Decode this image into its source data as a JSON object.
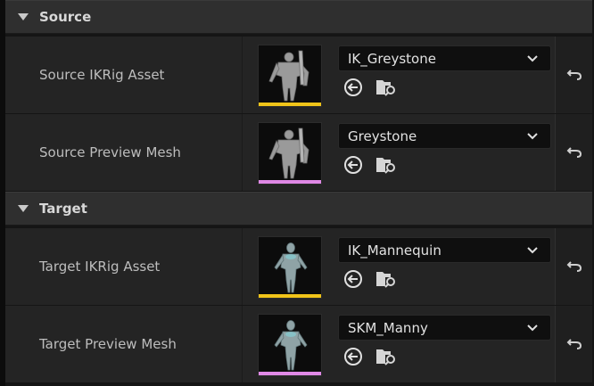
{
  "colors": {
    "ikrig_bar": "#f0c419",
    "mesh_bar": "#e089e6",
    "panel_bg": "#242424",
    "header_bg": "#2f2f2f"
  },
  "sections": [
    {
      "title": "Source",
      "rows": [
        {
          "label": "Source IKRig Asset",
          "value": "IK_Greystone",
          "asset_type": "ikrig",
          "thumb_icon": "greystone-thumbnail"
        },
        {
          "label": "Source Preview Mesh",
          "value": "Greystone",
          "asset_type": "mesh",
          "thumb_icon": "greystone-thumbnail"
        }
      ]
    },
    {
      "title": "Target",
      "rows": [
        {
          "label": "Target IKRig Asset",
          "value": "IK_Mannequin",
          "asset_type": "ikrig",
          "thumb_icon": "mannequin-thumbnail"
        },
        {
          "label": "Target Preview Mesh",
          "value": "SKM_Manny",
          "asset_type": "mesh",
          "thumb_icon": "mannequin-thumbnail"
        }
      ]
    }
  ],
  "icons": {
    "collapse": "triangle-down-icon",
    "dropdown": "chevron-down-icon",
    "use_selected": "use-selected-asset-icon",
    "browse": "browse-to-asset-icon",
    "reset": "reset-to-default-icon"
  }
}
